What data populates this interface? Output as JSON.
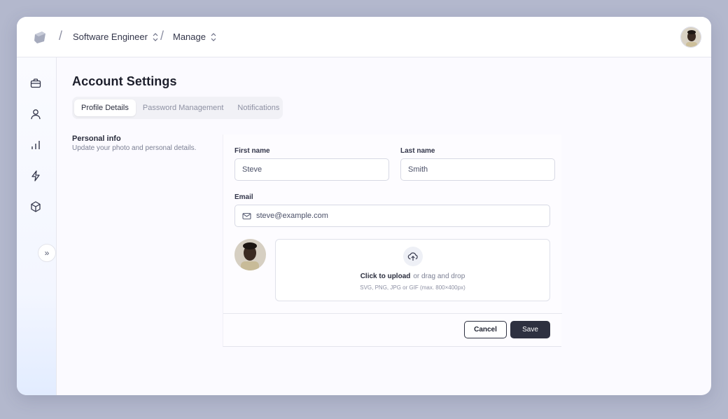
{
  "breadcrumb": {
    "project": "Software Engineer",
    "section": "Manage"
  },
  "page": {
    "title": "Account Settings"
  },
  "tabs": [
    {
      "label": "Profile Details",
      "active": true
    },
    {
      "label": "Password Management",
      "active": false
    },
    {
      "label": "Notifications",
      "active": false
    }
  ],
  "section": {
    "title": "Personal info",
    "description": "Update your photo and personal details."
  },
  "form": {
    "first_name_label": "First name",
    "first_name_value": "Steve",
    "last_name_label": "Last name",
    "last_name_value": "Smith",
    "email_label": "Email",
    "email_value": "steve@example.com"
  },
  "upload": {
    "cta": "Click to upload",
    "rest": "or drag and drop",
    "hint": "SVG, PNG, JPG or GIF (max. 800×400px)"
  },
  "actions": {
    "cancel_label": "Cancel",
    "save_label": "Save"
  },
  "sidebar": {
    "icons": [
      "briefcase-icon",
      "user-icon",
      "bar-chart-icon",
      "bolt-icon",
      "cube-icon"
    ],
    "expand_glyph": "»"
  },
  "colors": {
    "background": "#b3b8cd",
    "primary_button": "#2e3140",
    "surface": "#fbfaff"
  }
}
